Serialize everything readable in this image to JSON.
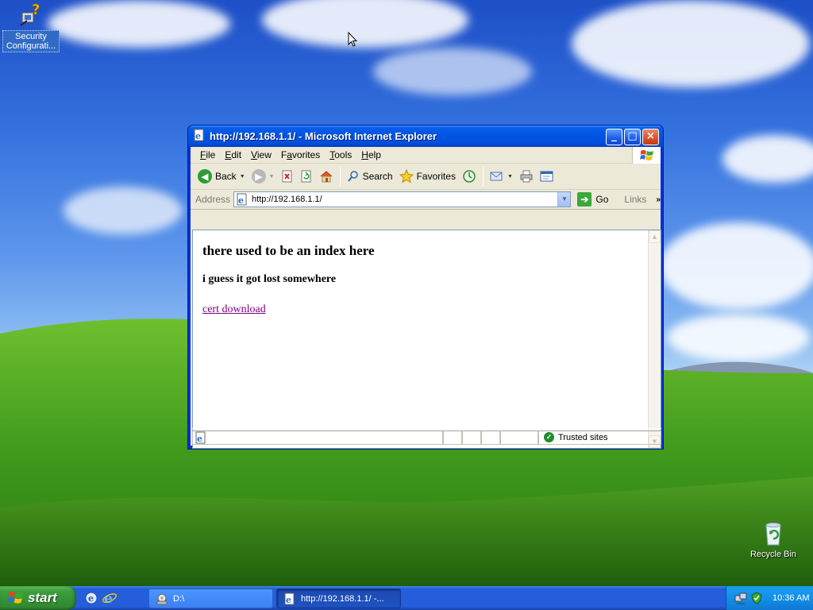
{
  "desktop": {
    "icons": [
      {
        "label": "Security Configurati...",
        "icon": "security-config-icon"
      },
      {
        "label": "Recycle Bin",
        "icon": "recycle-bin-icon"
      }
    ]
  },
  "window": {
    "title": "http://192.168.1.1/ - Microsoft Internet Explorer",
    "controls": {
      "minimize": "_",
      "maximize": "□",
      "close": "×"
    }
  },
  "menubar": {
    "items": [
      {
        "accel": "F",
        "rest": "ile"
      },
      {
        "accel": "E",
        "rest": "dit"
      },
      {
        "accel": "V",
        "rest": "iew"
      },
      {
        "accel": "F",
        "rest": "avorites",
        "pre": ""
      },
      {
        "accel": "T",
        "rest": "ools"
      },
      {
        "accel": "H",
        "rest": "elp"
      }
    ]
  },
  "toolbar": {
    "back_label": "Back",
    "search_label": "Search",
    "favorites_label": "Favorites"
  },
  "addressbar": {
    "label": "Address",
    "url": "http://192.168.1.1/",
    "go_label": "Go",
    "links_label": "Links"
  },
  "page": {
    "heading": "there used to be an index here",
    "subheading": "i guess it got lost somewhere",
    "link_text": "cert download"
  },
  "statusbar": {
    "zone": "Trusted sites"
  },
  "taskbar": {
    "start_label": "start",
    "tasks": [
      {
        "label": "D:\\",
        "state": "inactive"
      },
      {
        "label": "http://192.168.1.1/ -...",
        "state": "active"
      }
    ],
    "clock": "10:36 AM"
  },
  "colors": {
    "title_blue": "#0054e3",
    "taskbar_blue": "#245edb",
    "start_green": "#3c9f3c",
    "visited_link": "#800080",
    "window_face": "#ece9d8"
  }
}
